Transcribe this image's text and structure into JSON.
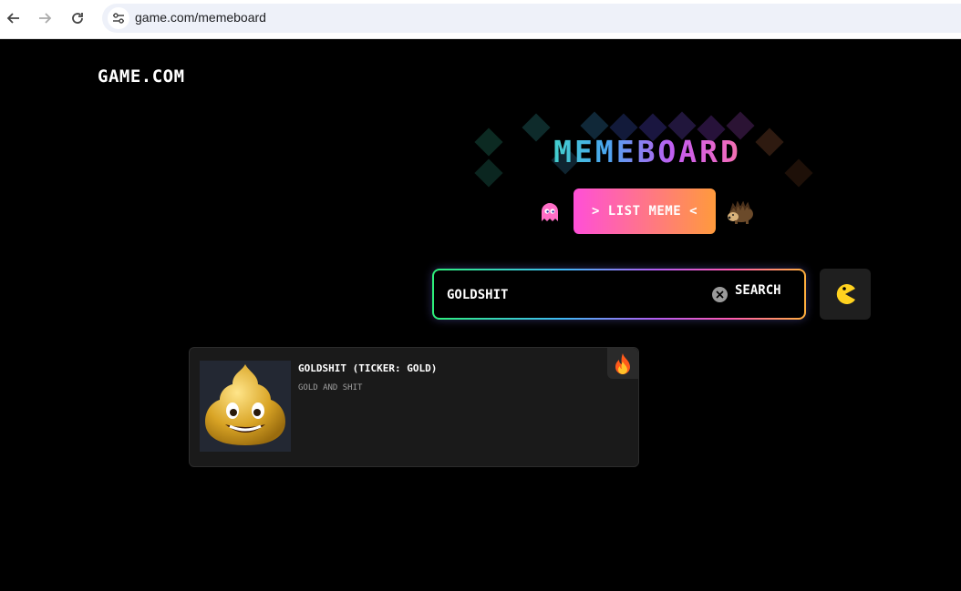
{
  "browser": {
    "url": "game.com/memeboard",
    "icons": [
      "back-arrow-icon",
      "forward-arrow-icon",
      "reload-icon",
      "site-settings-icon"
    ]
  },
  "site": {
    "logo": "GAME.COM",
    "title": "MEMEBOARD",
    "list_button": "> LIST MEME <"
  },
  "search": {
    "value": "GOLDSHIT",
    "button": "SEARCH"
  },
  "results": [
    {
      "title": "GOLDSHIT (TICKER: GOLD)",
      "description": "GOLD AND SHIT",
      "badge_icon": "fire-icon"
    }
  ],
  "colors": {
    "background": "#000000",
    "card": "#1a1a1a",
    "list_button_start": "#ff4fd8",
    "list_button_end": "#ff9a3c"
  }
}
